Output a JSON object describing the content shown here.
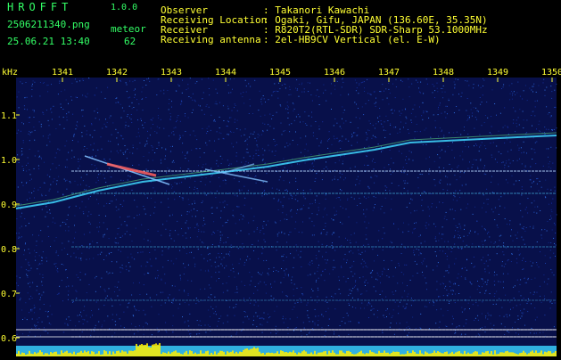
{
  "header": {
    "logo": "HROFFT",
    "version": "1.0.0",
    "filename": "2506211340.png",
    "mode": "meteor",
    "datetime": "25.06.21 13:40",
    "count": "62",
    "info": [
      {
        "label": "Observer",
        "value": ": Takanori Kawachi"
      },
      {
        "label": "Receiving Location",
        "value": ": Ogaki, Gifu, JAPAN (136.60E, 35.35N)"
      },
      {
        "label": "Receiver",
        "value": ": R820T2(RTL-SDR) SDR-Sharp 53.1000MHz"
      },
      {
        "label": "Receiving antenna",
        "value": ": 2el-HB9CV Vertical (el. E-W)"
      }
    ]
  },
  "axis": {
    "unit": "kHz",
    "x_ticks": [
      "1341",
      "1342",
      "1343",
      "1344",
      "1345",
      "1346",
      "1347",
      "1348",
      "1349",
      "1350"
    ],
    "y_ticks": [
      "1.1",
      "1.0",
      "0.9",
      "0.8",
      "0.7",
      "0.6"
    ]
  },
  "colors": {
    "background": "#000000",
    "spectrum_bg": "#08104a",
    "text_yellow": "#ffff33",
    "text_green": "#33ff66",
    "signal": "#40d8ff",
    "level_bar": "#ffee00"
  }
}
